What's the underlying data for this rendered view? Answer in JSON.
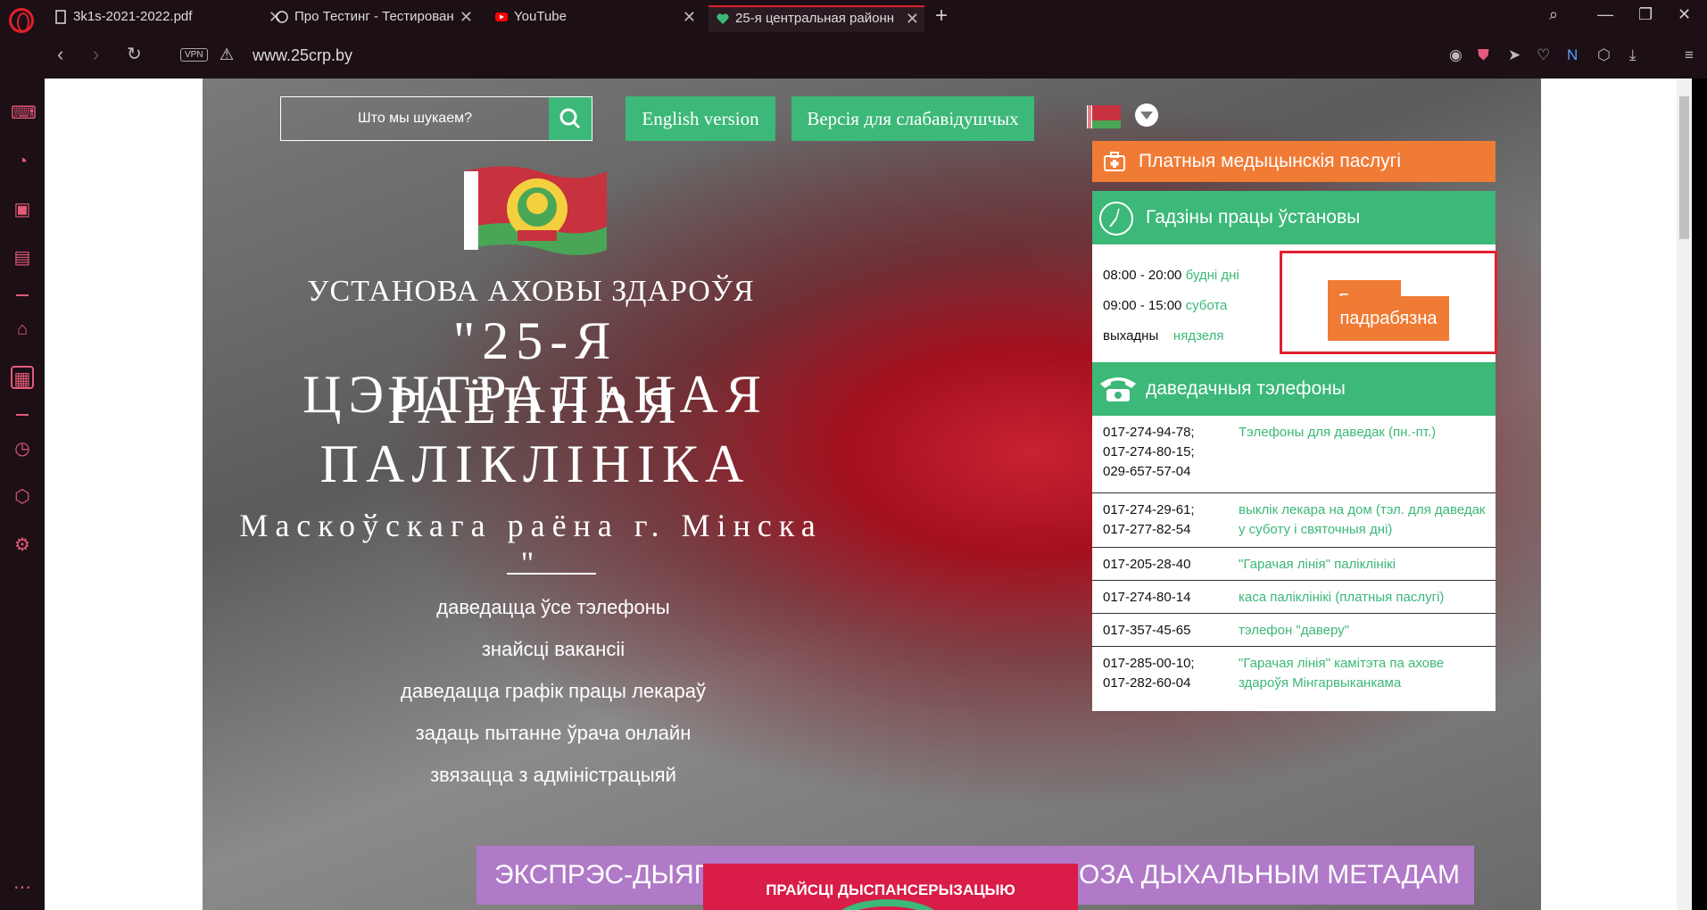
{
  "browser": {
    "tabs": [
      {
        "label": "3k1s-2021-2022.pdf"
      },
      {
        "label": "Про Тестинг - Тестирован"
      },
      {
        "label": "YouTube"
      },
      {
        "label": "25-я центральная районн"
      }
    ],
    "address": {
      "vpn": "VPN",
      "url": "www.25crp.by"
    }
  },
  "header": {
    "search_placeholder": "Што мы шукаем?",
    "english_label": "English version",
    "accessible_label": "Версія для слабавідушчых"
  },
  "hero": {
    "title_line1": "УСТАНОВА АХОВЫ ЗДАРОЎЯ",
    "title_line2": "\"25-Я ЦЭНТРАЛЬНАЯ",
    "title_line3": "РАЁННАЯ",
    "title_line4": "ПАЛІКЛІНІКА",
    "title_line5": "Маскоўскага раёна г. Мінска \"",
    "links": [
      "даведацца ўсе тэлефоны",
      "знайсці вакансіі",
      "даведацца графік працы лекараў",
      "задаць пытанне ўрача онлайн",
      "звязацца з адміністрацыяй"
    ]
  },
  "panel": {
    "paid_services": "Платныя медыцынскія паслугі",
    "hours_title": "Гадзіны працы ўстановы",
    "hours": [
      {
        "time": "08:00 - 20:00",
        "days": "будні дні"
      },
      {
        "time": "09:00 - 15:00",
        "days": "субота"
      },
      {
        "time": "выхадны",
        "days": "нядзеля"
      }
    ],
    "more_overflow": "Больш",
    "more_button": "падрабязна",
    "phones_title": "даведачныя тэлефоны",
    "phones": [
      {
        "numbers": "017-274-94-78;\n017-274-80-15;\n029-657-57-04",
        "desc": "Тэлефоны для даведак (пн.-пт.)"
      },
      {
        "numbers": "017-274-29-61;\n017-277-82-54",
        "desc": "выклік лекара на дом (тэл. для даведак у суботу і святочныя дні)"
      },
      {
        "numbers": "017-205-28-40",
        "desc": "\"Гарачая лінія\" паліклінікі"
      },
      {
        "numbers": "017-274-80-14",
        "desc": "каса паліклінікі (платныя паслугі)"
      },
      {
        "numbers": "017-357-45-65",
        "desc": "тэлефон \"даверу\""
      },
      {
        "numbers": "017-285-00-10;\n017-282-60-04",
        "desc": "\"Гарачая лінія\" камітэта па ахове здароўя Мінгарвыканкама"
      }
    ]
  },
  "banners": {
    "purple_left": "ЭКСПРЭС-ДЫЯГ",
    "purple_right": "ОЗА ДЫХАЛЬНЫМ МЕТАДАМ",
    "red": "ПРАЙСЦІ ДЫСПАНСЕРЫЗАЦЫЮ"
  },
  "colors": {
    "green": "#3cb878",
    "orange": "#f07b35",
    "purple": "#b07ac8",
    "red": "#d91c48",
    "opera_red": "#e0202e"
  }
}
